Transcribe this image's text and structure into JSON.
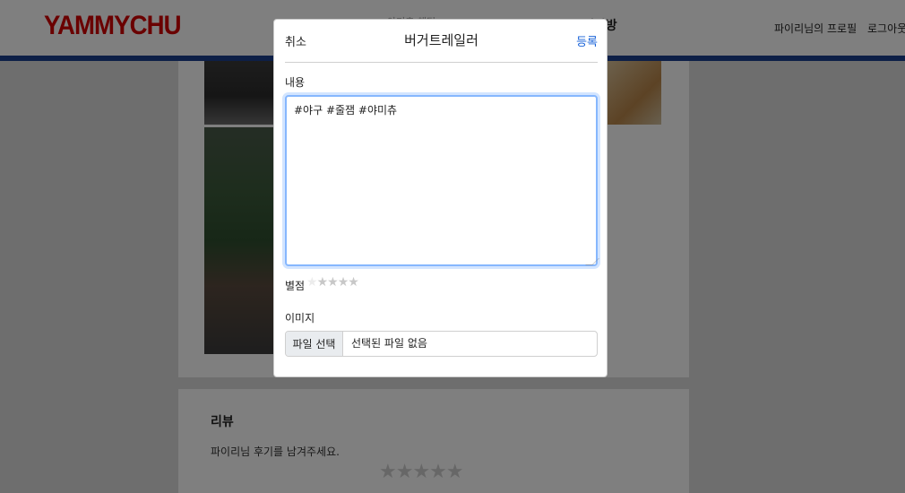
{
  "app": {
    "logo": "YAMMYCHU",
    "logo_color": "#d40000",
    "accent_color": "#1b3f8f"
  },
  "nav": {
    "faded_item": "야미츄 채팅",
    "chat_label": "채팅방",
    "profile_label": "파이리님의 프로필",
    "logout_label": "로그아웃"
  },
  "review": {
    "title": "리뷰",
    "prompt": "파이리님 후기를 남겨주세요.",
    "stars": "★★★★★",
    "rating": 0
  },
  "modal": {
    "cancel_label": "취소",
    "title": "버거트레일러",
    "submit_label": "등록",
    "submit_color": "#1a63d8",
    "content_label": "내용",
    "content_value": "#야구 #줄잼 #야미츄",
    "rating_label": "별점",
    "rating_stars": [
      "★",
      "★",
      "★",
      "★",
      "★"
    ],
    "rating_value": 0,
    "image_label": "이미지",
    "file_button_label": "파일 선택",
    "file_status": "선택된 파일 없음"
  }
}
